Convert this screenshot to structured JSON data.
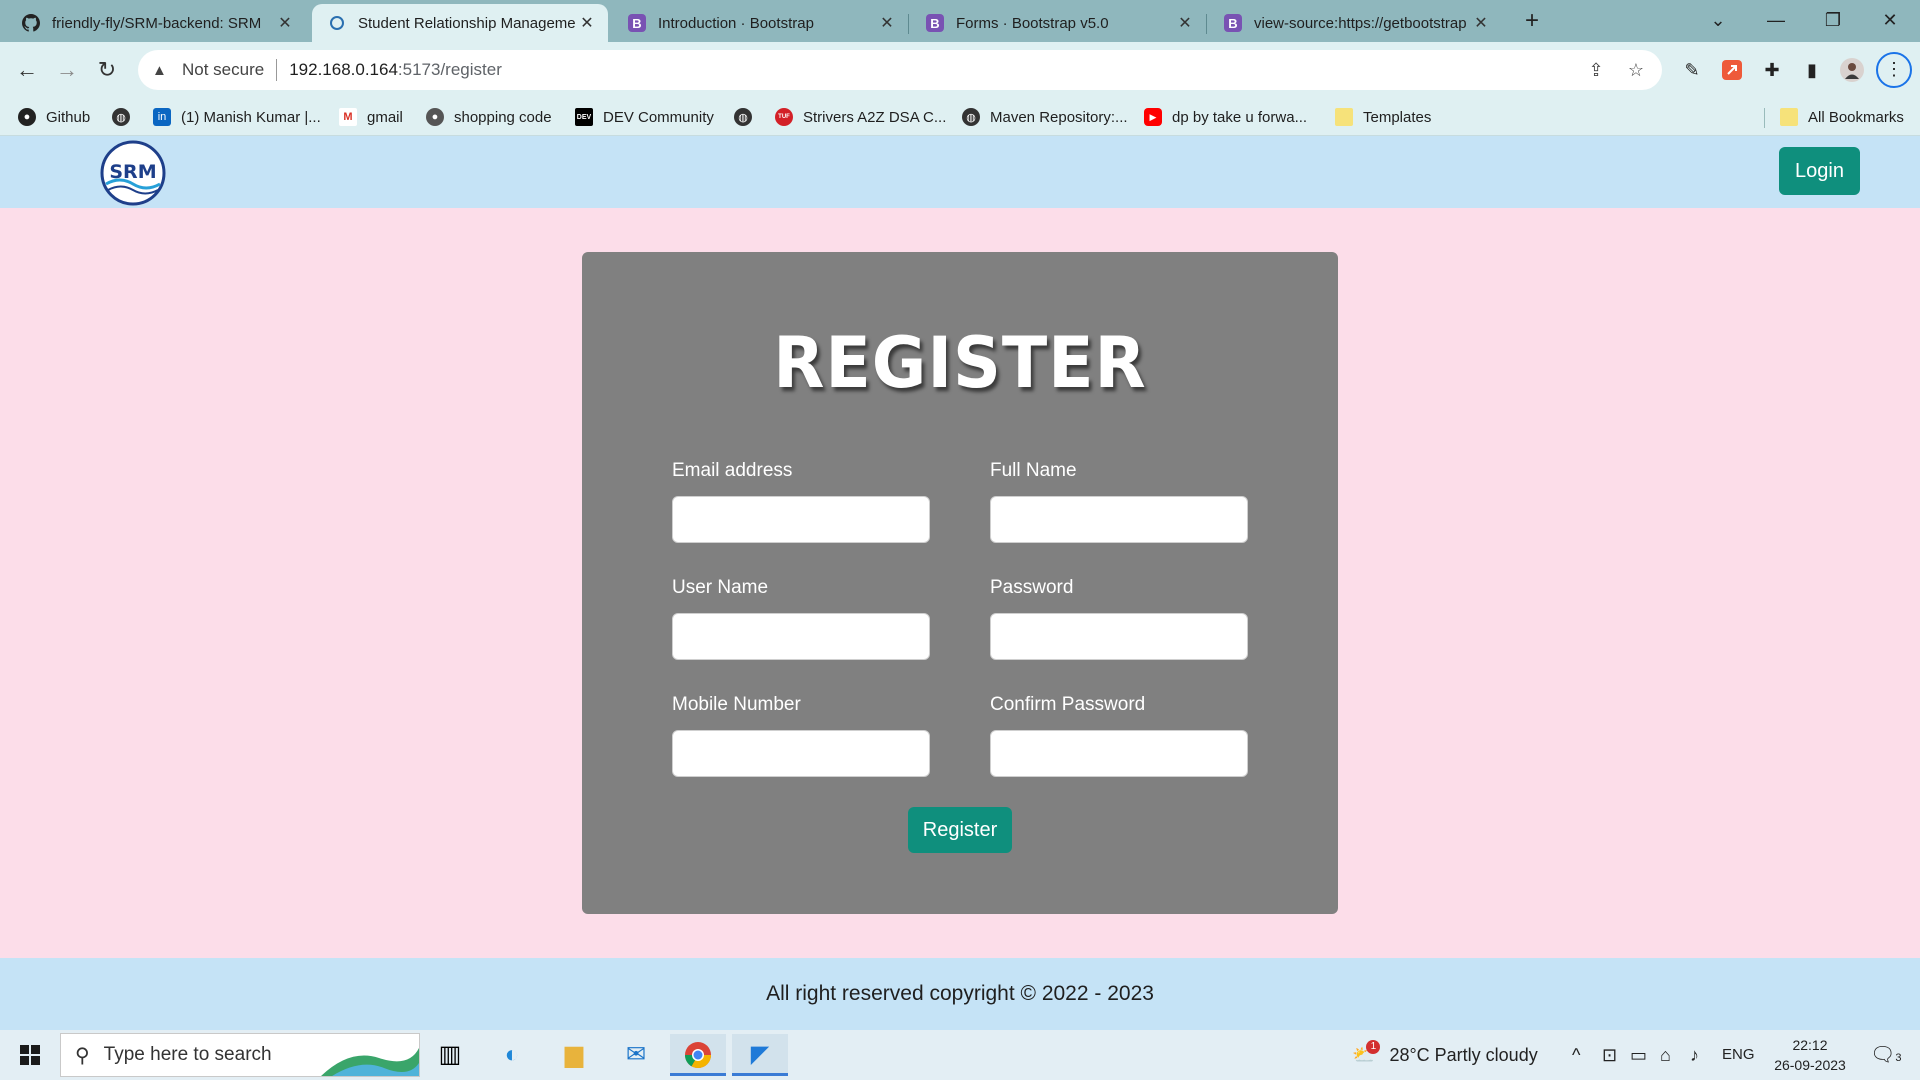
{
  "browser": {
    "tabs": [
      {
        "title": "friendly-fly/SRM-backend: SRM",
        "icon": "github-icon"
      },
      {
        "title": "Student Relationship Manageme",
        "icon": "srm-favicon-icon",
        "active": true
      },
      {
        "title": "Introduction · Bootstrap",
        "icon": "bootstrap-icon",
        "icon_glyph": "B"
      },
      {
        "title": "Forms · Bootstrap v5.0",
        "icon": "bootstrap-icon",
        "icon_glyph": "B"
      },
      {
        "title": "view-source:https://getbootstrap",
        "icon": "bootstrap-icon",
        "icon_glyph": "B"
      }
    ],
    "address": {
      "security_label": "Not secure",
      "host": "192.168.0.164",
      "path": ":5173/register"
    },
    "bookmarks": [
      {
        "label": "Github",
        "icon": "github-icon"
      },
      {
        "label": "",
        "icon": "globe-icon"
      },
      {
        "label": "(1) Manish Kumar |...",
        "icon": "linkedin-icon",
        "icon_glyph": "in"
      },
      {
        "label": "gmail",
        "icon": "gmail-icon",
        "icon_glyph": "M"
      },
      {
        "label": "shopping code",
        "icon": "github-icon"
      },
      {
        "label": "DEV Community",
        "icon": "dev-icon",
        "icon_glyph": "DEV"
      },
      {
        "label": "",
        "icon": "globe-icon"
      },
      {
        "label": "Strivers A2Z DSA C...",
        "icon": "tuf-icon",
        "icon_glyph": "TUF"
      },
      {
        "label": "Maven Repository:...",
        "icon": "globe-icon"
      },
      {
        "label": "dp by take u forwa...",
        "icon": "youtube-icon"
      },
      {
        "label": "Templates",
        "icon": "folder-icon"
      }
    ],
    "all_bookmarks_label": "All Bookmarks"
  },
  "navbar": {
    "logo_text": "SRM",
    "login_label": "Login"
  },
  "form": {
    "title": "REGISTER",
    "fields": {
      "email_label": "Email address",
      "full_name_label": "Full Name",
      "user_name_label": "User Name",
      "password_label": "Password",
      "mobile_label": "Mobile Number",
      "confirm_password_label": "Confirm Password"
    },
    "submit_label": "Register"
  },
  "footer": {
    "text": "All right reserved copyright © 2022 - 2023"
  },
  "taskbar": {
    "search_placeholder": "Type here to search",
    "weather": "28°C  Partly cloudy",
    "weather_badge": "1",
    "language": "ENG",
    "time": "22:12",
    "date": "26-09-2023",
    "notification_count": "3"
  },
  "colors": {
    "page_bg": "#fcdde9",
    "navbar_bg": "#c5e3f6",
    "card_bg": "#808080",
    "accent": "#0f8f7d"
  }
}
